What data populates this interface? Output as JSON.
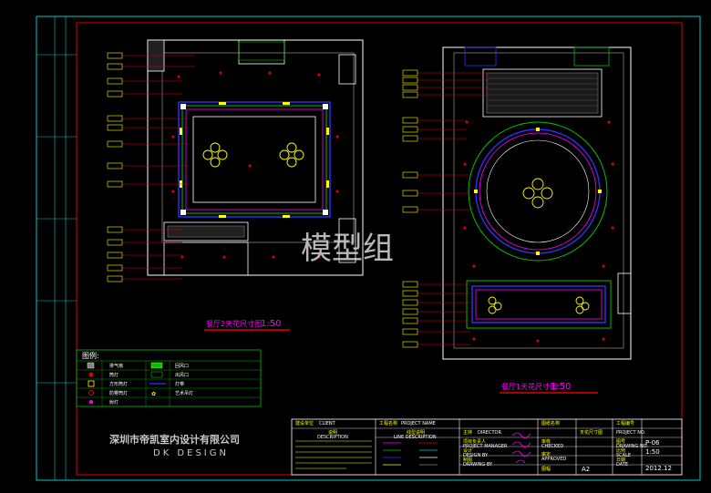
{
  "watermark": "模型组",
  "company": {
    "name_cn": "深圳市帝凯室内设计有限公司",
    "name_en": "DK DESIGN"
  },
  "drawings": {
    "left_caption": "餐厅2天花尺寸图",
    "left_scale": "1:50",
    "right_caption": "餐厅1天花尺寸图",
    "right_scale": "1:50"
  },
  "legend": {
    "title": "图例:",
    "items": [
      {
        "label": "排气扇",
        "label2": "回风口"
      },
      {
        "label": "筒灯",
        "label2": "出风口"
      },
      {
        "label": "方形筒灯",
        "label2": "灯带"
      },
      {
        "label": "防雾筒灯",
        "label2": "艺术吊灯"
      },
      {
        "label": "射灯",
        "label2": ""
      }
    ]
  },
  "title_block": {
    "client_label": "建设单位",
    "client_en": "CLIENT",
    "description_label": "说明",
    "description_en": "DESCRIPTION",
    "project_label": "工程名称",
    "project_en": "PROJECT NAME",
    "line_desc_label": "线型说明",
    "line_desc_en": "LINE DESCRIPTION",
    "director_label": "主持",
    "director_en": "DIRECTOR",
    "manager_label": "项目负责人",
    "manager_en": "PROJECT MANAGER",
    "design_label": "设计",
    "design_en": "DESIGN BY",
    "drawing_label": "制图",
    "drawing_en": "DRAWING BY",
    "checked_label": "审核",
    "checked_en": "CHECKED",
    "approved_label": "审定",
    "approved_en": "APPROVED",
    "sheet_label": "图幅",
    "sheet_value": "A2",
    "drawing_title_label": "图纸名称",
    "drawing_title_value": "天花尺寸图",
    "project_no_label": "工程编号",
    "project_no_en": "PROJECT NO.",
    "drawing_no_label": "图号",
    "drawing_no_en": "DRAWING NO.",
    "drawing_no_value": "P-06",
    "scale_label": "比例",
    "scale_en": "SCALE",
    "scale_value": "1:50",
    "date_label": "日期",
    "date_en": "DATE",
    "date_value": "2012.12"
  },
  "colors": {
    "frame_red": "#e00000",
    "cyan": "#00c8c8",
    "yellow": "#ffff00",
    "white": "#ffffff",
    "green": "#00c000",
    "magenta": "#ff00ff",
    "blue": "#3030ff"
  }
}
